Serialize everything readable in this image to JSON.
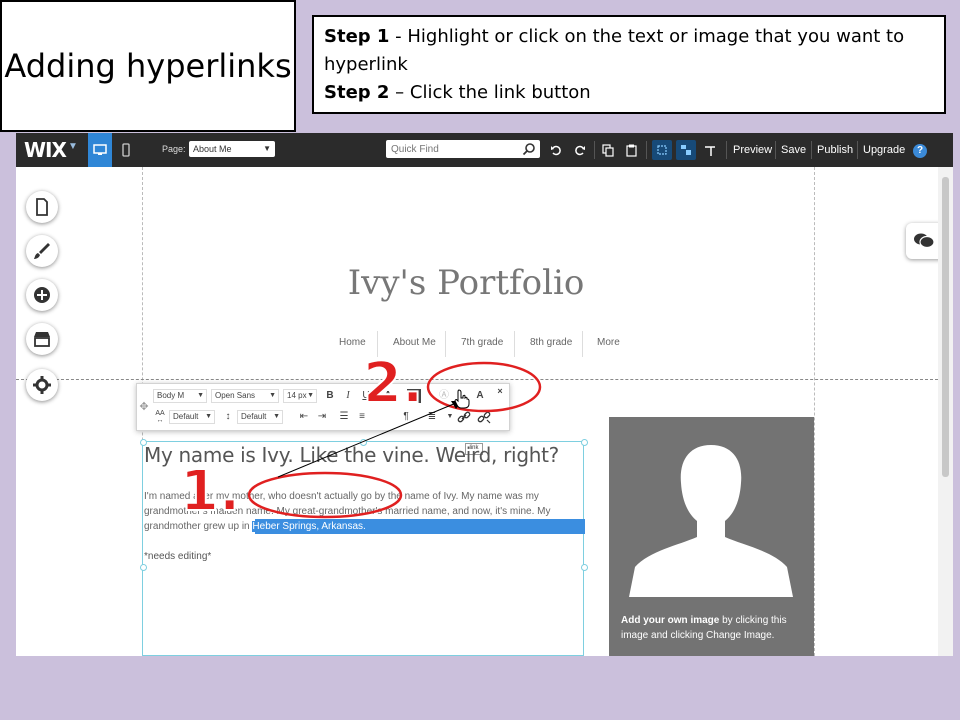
{
  "slide": {
    "title": "Adding hyperlinks",
    "step1_label": "Step 1",
    "step1_text": " - Highlight or click on the text or image that you want to hyperlink",
    "step2_label": "Step 2",
    "step2_text": " – Click the link button"
  },
  "editor": {
    "logo": "WIX",
    "page_label": "Page:",
    "page_select": "About Me",
    "quick_find_placeholder": "Quick Find",
    "menu": [
      "Preview",
      "Save",
      "Publish",
      "Upgrade"
    ],
    "help": "?"
  },
  "site": {
    "title": "Ivy's Portfolio",
    "nav": [
      "Home",
      "About Me",
      "7th grade",
      "8th grade",
      "More"
    ],
    "heading": "My name is Ivy. Like the vine. Weird, right?",
    "para_line1": "I'm named after my mother, who doesn't actually go by the name of Ivy. My name was my",
    "para_line2": "grandmother's maiden name. My great-grandmother's married name, and now, it's mine. My",
    "para_line3_prefix": "grandmother grew up in ",
    "para_line3_highlight": "Heber Springs, Arkansas.",
    "needs_editing": "*needs editing*",
    "image_caption_bold": "Add your own image",
    "image_caption_rest": " by clicking this image and clicking Change Image."
  },
  "text_toolbar": {
    "style_select": "Body M",
    "font_select": "Open Sans",
    "size_select": "14 px",
    "bold": "B",
    "italic": "I",
    "underline": "U",
    "spacing_select": "Default",
    "line_height_select": "Default",
    "link_tooltip": "link"
  },
  "annotations": {
    "step1_number": "1.",
    "step2_number": "2."
  },
  "colors": {
    "background": "#cbc0dc",
    "wix_bar": "#2b2b2b",
    "highlight": "#3b8ee0",
    "annotation_red": "#e02020"
  }
}
